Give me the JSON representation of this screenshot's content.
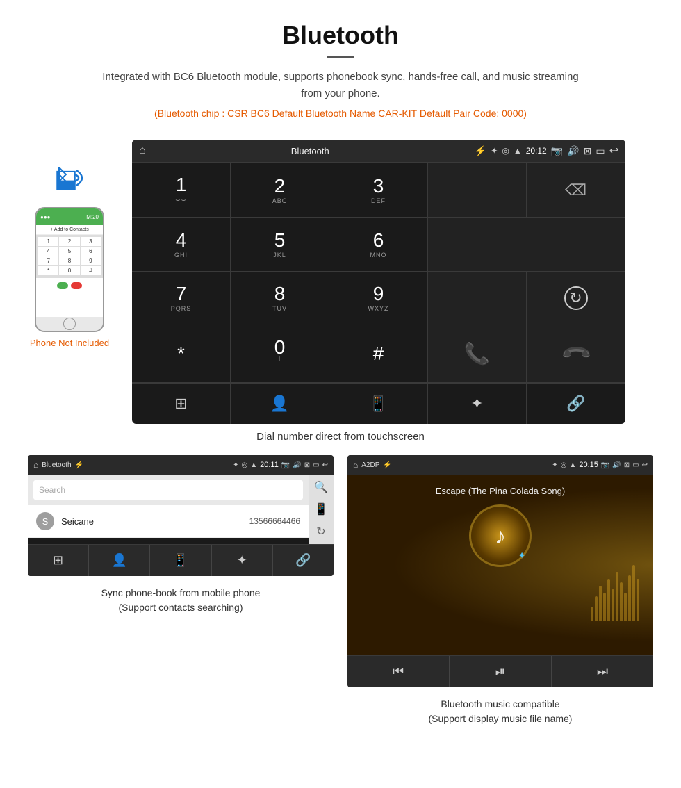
{
  "header": {
    "title": "Bluetooth",
    "description": "Integrated with BC6 Bluetooth module, supports phonebook sync, hands-free call, and music streaming from your phone.",
    "specs": "(Bluetooth chip : CSR BC6   Default Bluetooth Name CAR-KIT    Default Pair Code: 0000)"
  },
  "phone_label": "Phone Not Included",
  "main_screen": {
    "status_bar": {
      "title": "Bluetooth",
      "time": "20:12"
    },
    "dialpad": [
      {
        "number": "1",
        "sub": "⌣⌣"
      },
      {
        "number": "2",
        "sub": "ABC"
      },
      {
        "number": "3",
        "sub": "DEF"
      },
      {
        "number": "",
        "sub": ""
      },
      {
        "number": "",
        "sub": ""
      },
      {
        "number": "4",
        "sub": "GHI"
      },
      {
        "number": "5",
        "sub": "JKL"
      },
      {
        "number": "6",
        "sub": "MNO"
      },
      {
        "number": "",
        "sub": ""
      },
      {
        "number": "",
        "sub": ""
      },
      {
        "number": "7",
        "sub": "PQRS"
      },
      {
        "number": "8",
        "sub": "TUV"
      },
      {
        "number": "9",
        "sub": "WXYZ"
      },
      {
        "number": "",
        "sub": ""
      },
      {
        "number": "",
        "sub": ""
      },
      {
        "number": "*",
        "sub": ""
      },
      {
        "number": "0",
        "sub": "+"
      },
      {
        "number": "#",
        "sub": ""
      },
      {
        "number": "",
        "sub": ""
      },
      {
        "number": "",
        "sub": ""
      }
    ]
  },
  "main_caption": "Dial number direct from touchscreen",
  "phonebook_screen": {
    "status_bar": {
      "title": "Bluetooth",
      "time": "20:11"
    },
    "search_placeholder": "Search",
    "contact": {
      "letter": "S",
      "name": "Seicane",
      "number": "13566664466"
    }
  },
  "music_screen": {
    "status_bar": {
      "title": "A2DP",
      "time": "20:15"
    },
    "song_title": "Escape (The Pina Colada Song)"
  },
  "bottom_captions": {
    "phonebook": "Sync phone-book from mobile phone\n(Support contacts searching)",
    "music": "Bluetooth music compatible\n(Support display music file name)"
  }
}
